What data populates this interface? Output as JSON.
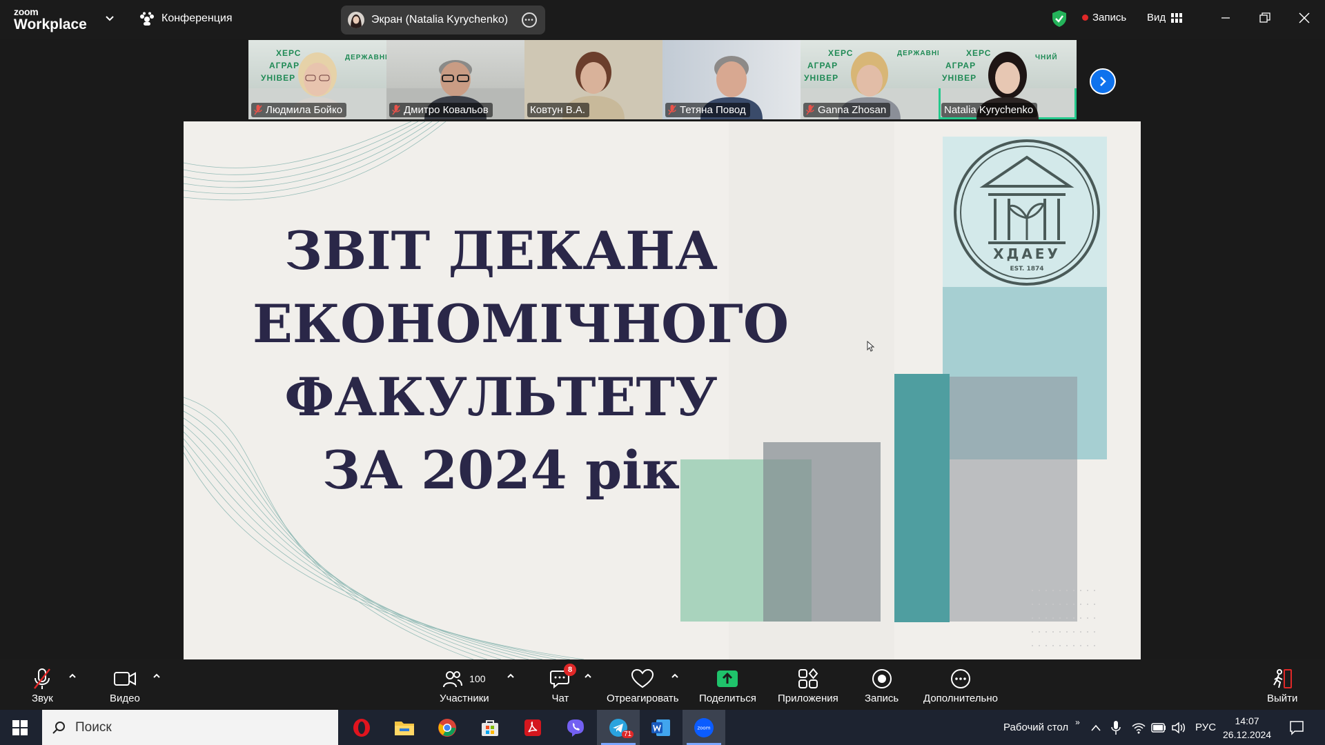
{
  "app": {
    "logo_line1": "zoom",
    "logo_line2": "Workplace",
    "conference_label": "Конференция",
    "share_pill_label": "Экран (Natalia Kyrychenko)",
    "record_label": "Запись",
    "view_label": "Вид"
  },
  "participants": [
    {
      "name": "Людмила Бойко",
      "muted": true,
      "active": false
    },
    {
      "name": "Дмитро Ковальов",
      "muted": true,
      "active": false
    },
    {
      "name": "Ковтун В.А.",
      "muted": false,
      "active": false
    },
    {
      "name": "Тетяна Повод",
      "muted": true,
      "active": false
    },
    {
      "name": "Ganna Zhosan",
      "muted": true,
      "active": false
    },
    {
      "name": "Natalia Kyrychenko",
      "muted": false,
      "active": true
    }
  ],
  "slide": {
    "title_lines": [
      "ЗВІТ ДЕКАНА",
      "ЕКОНОМІЧНОГО",
      "ФАКУЛЬТЕТУ",
      "ЗА 2024 рік"
    ],
    "emblem_text": "ХДАЕУ",
    "emblem_est": "EST. 1874",
    "banner_text_a": "ХЕРС",
    "banner_text_b": "АГРАР",
    "banner_text_c": "УНІВЕР",
    "banner_text_d": "ДЕРЖАВНИЙ",
    "banner_text_e": "ЧНИЙ"
  },
  "toolbar": {
    "audio": "Звук",
    "video": "Видео",
    "participants": "Участники",
    "participants_count": "100",
    "chat": "Чат",
    "chat_badge": "8",
    "react": "Отреагировать",
    "share": "Поделиться",
    "apps": "Приложения",
    "record": "Запись",
    "more": "Дополнительно",
    "leave": "Выйти"
  },
  "taskbar": {
    "search_placeholder": "Поиск",
    "desktop_label": "Рабочий стол",
    "lang": "РУС",
    "time": "14:07",
    "date": "26.12.2024",
    "telegram_badge": "71"
  },
  "colors": {
    "accent_blue": "#0e72ed",
    "active_green": "#24c98c",
    "record_red": "#e02828",
    "slide_title": "#2a2748",
    "slide_bg": "#f1efeb",
    "share_green": "#1fc36b"
  }
}
